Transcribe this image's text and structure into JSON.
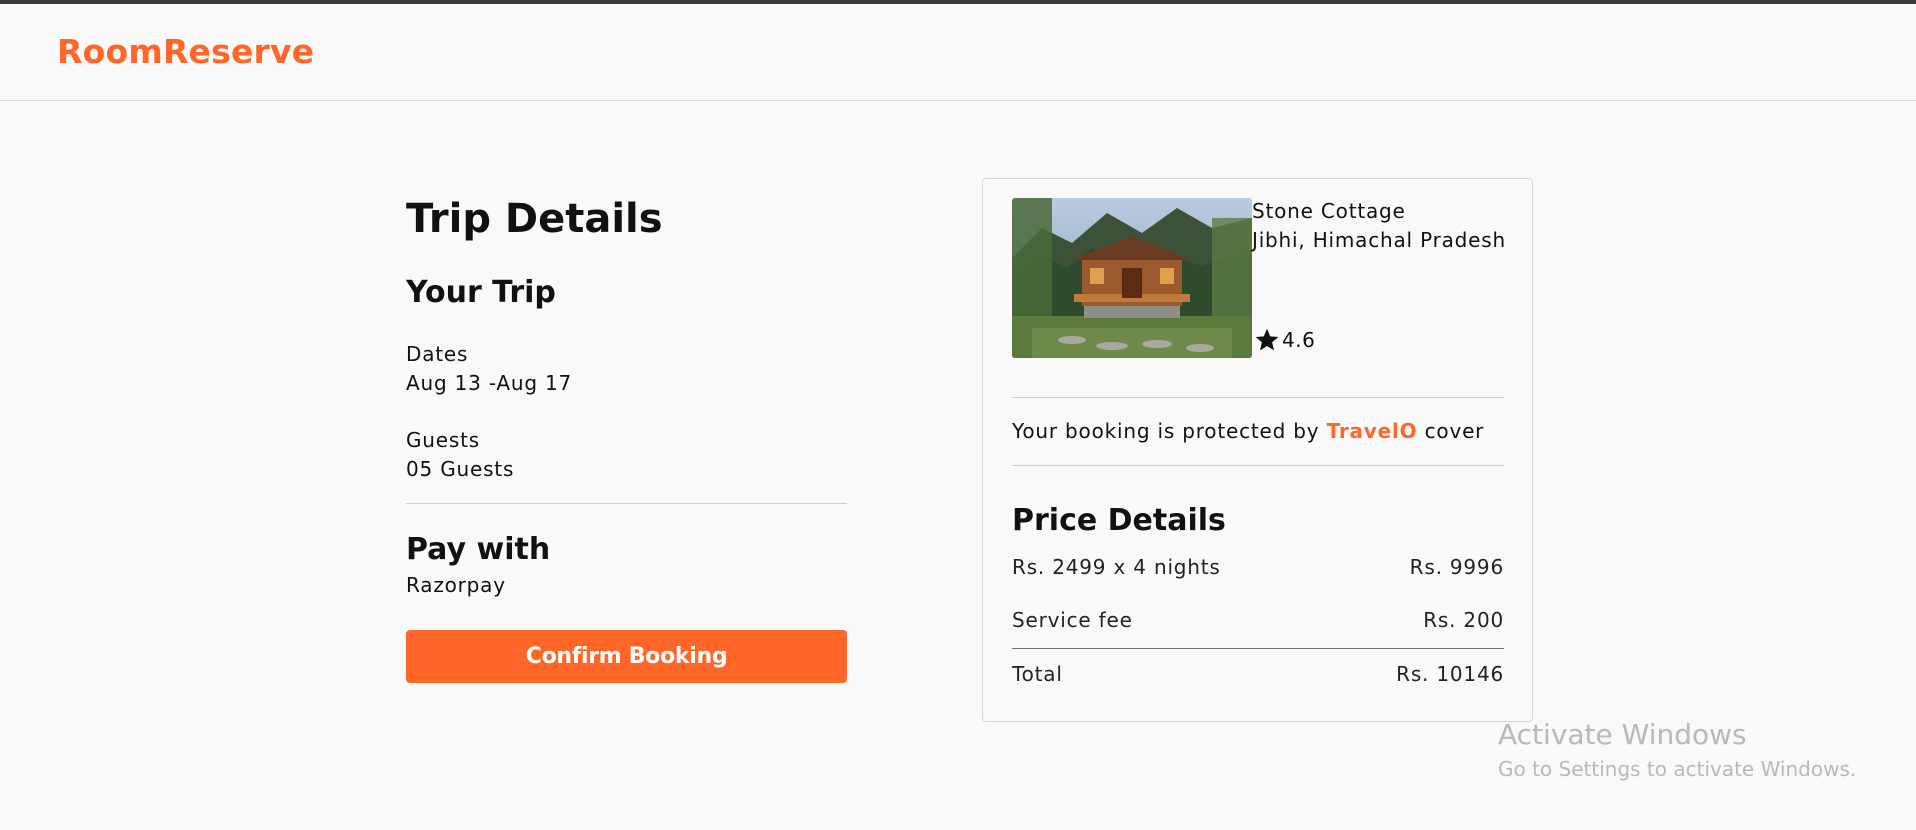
{
  "header": {
    "brand": "RoomReserve"
  },
  "trip": {
    "title": "Trip Details",
    "your_trip": "Your Trip",
    "dates_label": "Dates",
    "dates_value": "Aug 13 -Aug 17",
    "guests_label": "Guests",
    "guests_value": "05 Guests",
    "pay_title": "Pay with",
    "pay_value": "Razorpay",
    "confirm_label": "Confirm Booking"
  },
  "property": {
    "name": "Stone Cottage",
    "location": "Jibhi, Himachal Pradesh",
    "rating": "4.6",
    "image_alt": "stone-cottage-photo"
  },
  "protection": {
    "prefix": "Your booking is protected by ",
    "brand": "TravelO",
    "suffix": " cover"
  },
  "price": {
    "title": "Price Details",
    "rows": [
      {
        "label": "Rs. 2499 x 4 nights",
        "value": "Rs. 9996"
      },
      {
        "label": "Service fee",
        "value": "Rs. 200"
      },
      {
        "label": "Total",
        "value": "Rs. 10146"
      }
    ]
  },
  "watermark": {
    "title": "Activate Windows",
    "subtitle": "Go to Settings to activate Windows."
  },
  "colors": {
    "accent": "#ff6628",
    "background": "#f9f9f9"
  },
  "icons": {
    "rating": "star-icon"
  }
}
